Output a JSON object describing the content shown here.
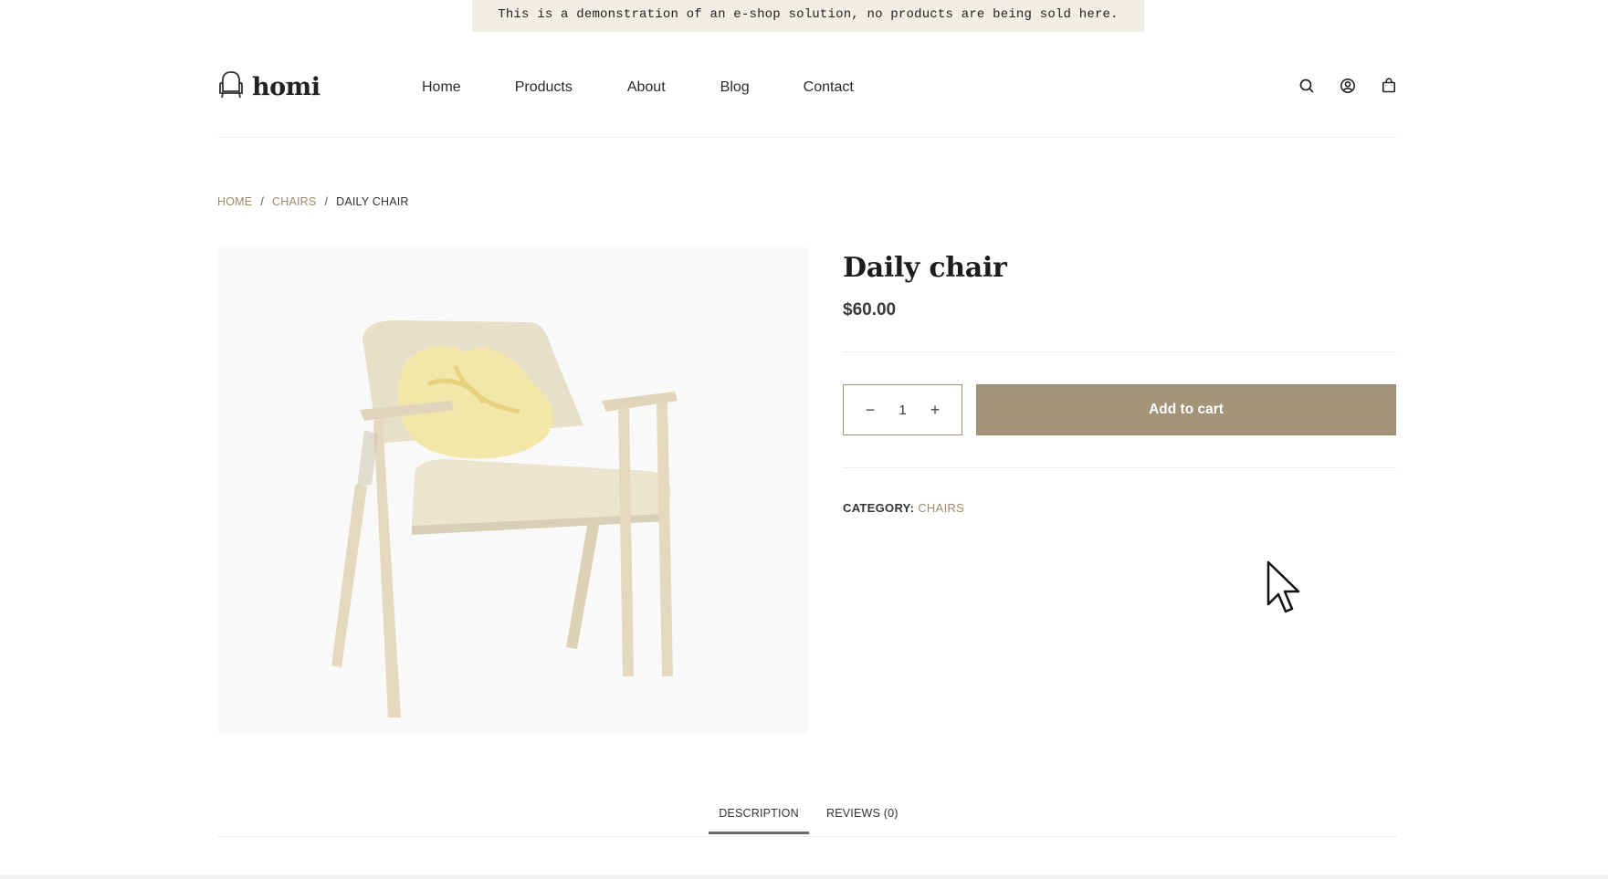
{
  "notice": {
    "text": "This is a demonstration of an e-shop solution, no products are being sold here."
  },
  "header": {
    "logo_text": "homi",
    "logo_icon": "armchair-icon",
    "nav": [
      "Home",
      "Products",
      "About",
      "Blog",
      "Contact"
    ],
    "icons": [
      "search-icon",
      "account-icon",
      "cart-bag-icon"
    ]
  },
  "breadcrumb": {
    "home": "HOME",
    "sep": "/",
    "category": "CHAIRS",
    "current": "DAILY CHAIR"
  },
  "product": {
    "title": "Daily chair",
    "price": "$60.00",
    "quantity": "1",
    "minus": "−",
    "plus": "+",
    "add_to_cart": "Add to cart",
    "category_label": "CATEGORY:",
    "category_value": "CHAIRS"
  },
  "tabs": {
    "description": "DESCRIPTION",
    "reviews": "REVIEWS (0)"
  },
  "colors": {
    "accent": "#a39479",
    "link": "#a08a67",
    "notice_bg": "#f1eee6"
  }
}
